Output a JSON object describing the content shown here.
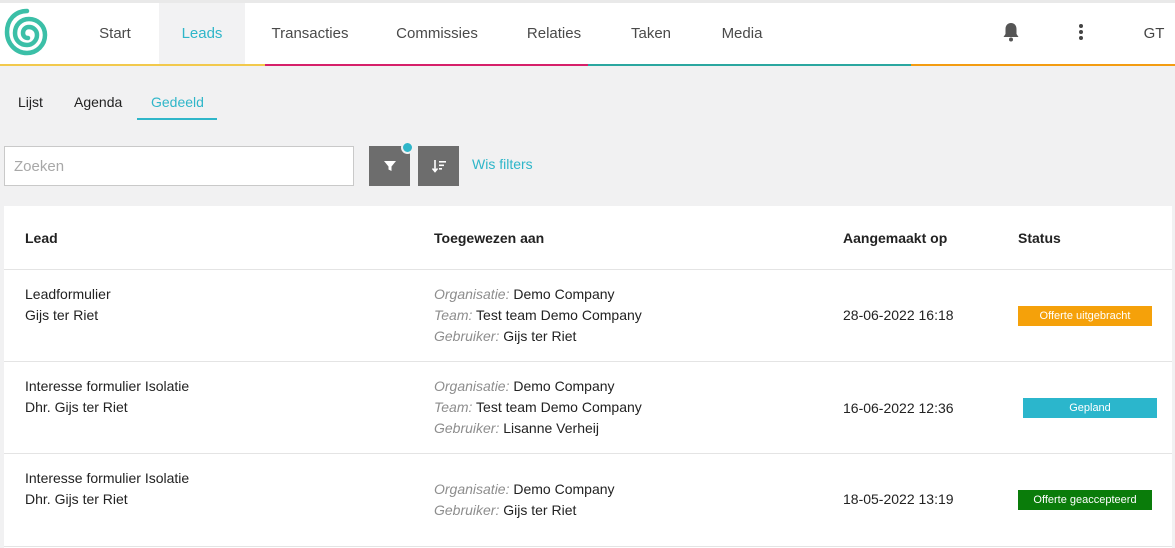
{
  "nav": {
    "items": [
      {
        "label": "Start",
        "active": false
      },
      {
        "label": "Leads",
        "active": true
      },
      {
        "label": "Transacties",
        "active": false
      },
      {
        "label": "Commissies",
        "active": false
      },
      {
        "label": "Relaties",
        "active": false
      },
      {
        "label": "Taken",
        "active": false
      },
      {
        "label": "Media",
        "active": false
      }
    ],
    "user_initials": "GT",
    "colors": [
      "#f2c94c",
      "#d6206a",
      "#2ba7a0",
      "#f39c12"
    ]
  },
  "subtabs": [
    {
      "label": "Lijst",
      "active": false
    },
    {
      "label": "Agenda",
      "active": false
    },
    {
      "label": "Gedeeld",
      "active": true
    }
  ],
  "toolbar": {
    "search_placeholder": "Zoeken",
    "search_value": "",
    "clear_filters": "Wis filters"
  },
  "table": {
    "headers": [
      "Lead",
      "Toegewezen aan",
      "Aangemaakt op",
      "Status"
    ],
    "rows": [
      {
        "lead_title": "Leadformulier",
        "lead_name": "Gijs ter Riet",
        "assigned": [
          {
            "label": "Organisatie:",
            "value": "Demo Company"
          },
          {
            "label": "Team:",
            "value": "Test team Demo Company"
          },
          {
            "label": "Gebruiker:",
            "value": "Gijs ter Riet"
          }
        ],
        "created": "28-06-2022 16:18",
        "status": "Offerte uitgebracht",
        "status_color": "#f5a10a"
      },
      {
        "lead_title": "Interesse formulier Isolatie",
        "lead_name": "Dhr. Gijs ter Riet",
        "assigned": [
          {
            "label": "Organisatie:",
            "value": "Demo Company"
          },
          {
            "label": "Team:",
            "value": "Test team Demo Company"
          },
          {
            "label": "Gebruiker:",
            "value": "Lisanne Verheij"
          }
        ],
        "created": "16-06-2022 12:36",
        "status": "Gepland",
        "status_color": "#2bb6cc"
      },
      {
        "lead_title": "Interesse formulier Isolatie",
        "lead_name": "Dhr. Gijs ter Riet",
        "assigned": [
          {
            "label": "Organisatie:",
            "value": "Demo Company"
          },
          {
            "label": "Gebruiker:",
            "value": "Gijs ter Riet"
          }
        ],
        "created": "18-05-2022 13:19",
        "status": "Offerte geaccepteerd",
        "status_color": "#0a7c0a"
      }
    ]
  }
}
